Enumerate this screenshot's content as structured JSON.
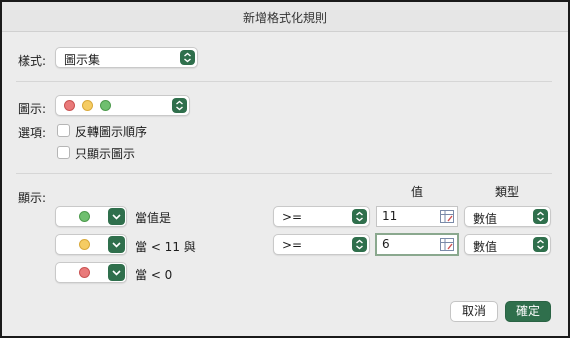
{
  "window": {
    "title": "新增格式化規則"
  },
  "style": {
    "label": "樣式:",
    "value": "圖示集"
  },
  "icons": {
    "label": "圖示:"
  },
  "options": {
    "label": "選項:",
    "reverse_order": "反轉圖示順序",
    "show_icon_only": "只顯示圖示"
  },
  "display": {
    "label": "顯示:",
    "value_header": "值",
    "type_header": "類型",
    "rules": [
      {
        "condition": "當值是",
        "operator": ">=",
        "value": "11",
        "type": "數值"
      },
      {
        "condition": "當 < 11 與",
        "operator": ">=",
        "value": "6",
        "type": "數值"
      },
      {
        "condition": "當 < 0"
      }
    ]
  },
  "buttons": {
    "cancel": "取消",
    "ok": "確定"
  },
  "colors": {
    "accent": "#2f6f4c",
    "red": "#e97a7a",
    "yellow": "#f5cc63",
    "green": "#6fbf6f"
  }
}
